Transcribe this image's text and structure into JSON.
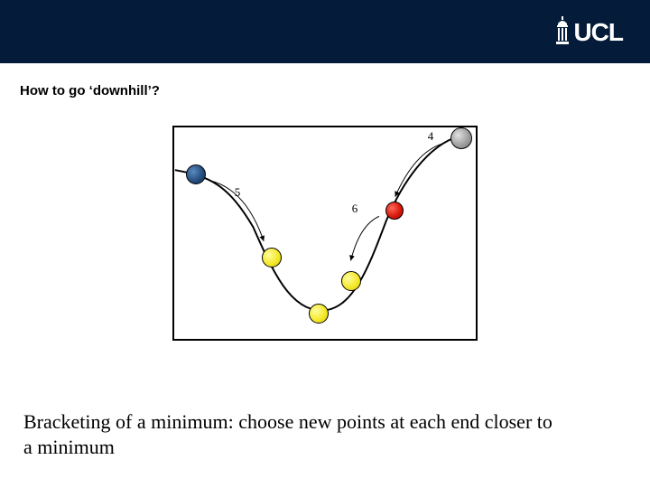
{
  "header": {
    "logo_text": "UCL"
  },
  "title": "How to go ‘downhill’?",
  "diagram": {
    "labels": {
      "n4": "4",
      "n5": "5",
      "n6": "6"
    }
  },
  "caption": "Bracketing of a minimum: choose new points at each end closer to a minimum"
}
